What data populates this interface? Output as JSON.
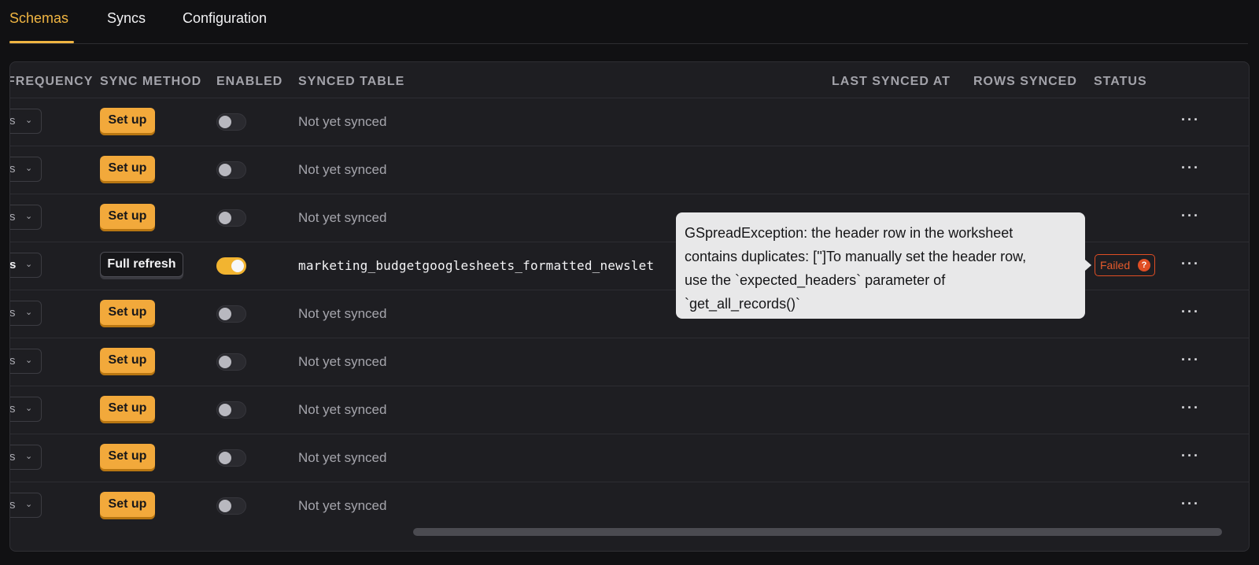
{
  "tabs": [
    {
      "label": "Schemas",
      "active": true
    },
    {
      "label": "Syncs",
      "active": false
    },
    {
      "label": "Configuration",
      "active": false
    }
  ],
  "table": {
    "headers": {
      "frequency": "FREQUENCY",
      "sync_method": "SYNC METHOD",
      "enabled": "ENABLED",
      "synced_table": "SYNCED TABLE",
      "last_synced_at": "LAST SYNCED AT",
      "rows_synced": "ROWS SYNCED",
      "status": "STATUS"
    },
    "rows": [
      {
        "frequency": "s",
        "sync_method": "Set up",
        "enabled": false,
        "synced_table": "Not yet synced",
        "status": ""
      },
      {
        "frequency": "s",
        "sync_method": "Set up",
        "enabled": false,
        "synced_table": "Not yet synced",
        "status": ""
      },
      {
        "frequency": "s",
        "sync_method": "Set up",
        "enabled": false,
        "synced_table": "Not yet synced",
        "status": ""
      },
      {
        "frequency": "s",
        "sync_method": "Full refresh",
        "enabled": true,
        "synced_table": "marketing_budgetgooglesheets_formatted_newslet",
        "status": "Failed"
      },
      {
        "frequency": "s",
        "sync_method": "Set up",
        "enabled": false,
        "synced_table": "Not yet synced",
        "status": ""
      },
      {
        "frequency": "s",
        "sync_method": "Set up",
        "enabled": false,
        "synced_table": "Not yet synced",
        "status": ""
      },
      {
        "frequency": "s",
        "sync_method": "Set up",
        "enabled": false,
        "synced_table": "Not yet synced",
        "status": ""
      },
      {
        "frequency": "s",
        "sync_method": "Set up",
        "enabled": false,
        "synced_table": "Not yet synced",
        "status": ""
      },
      {
        "frequency": "s",
        "sync_method": "Set up",
        "enabled": false,
        "synced_table": "Not yet synced",
        "status": ""
      }
    ],
    "row_menu_icon": "more-horizontal-icon",
    "status_help_icon": "question-circle-icon",
    "status_help_glyph": "?"
  },
  "tooltip": {
    "lines": [
      "GSpreadException: the header row in the worksheet",
      "contains duplicates: ['']To manually set the header row,",
      "use the `expected_headers` parameter of",
      "`get_all_records()`"
    ]
  },
  "colors": {
    "accent": "#f0b542",
    "setup_button": "#f2a93b",
    "failed": "#e04e24",
    "background": "#111113",
    "panel": "#1e1e22"
  }
}
